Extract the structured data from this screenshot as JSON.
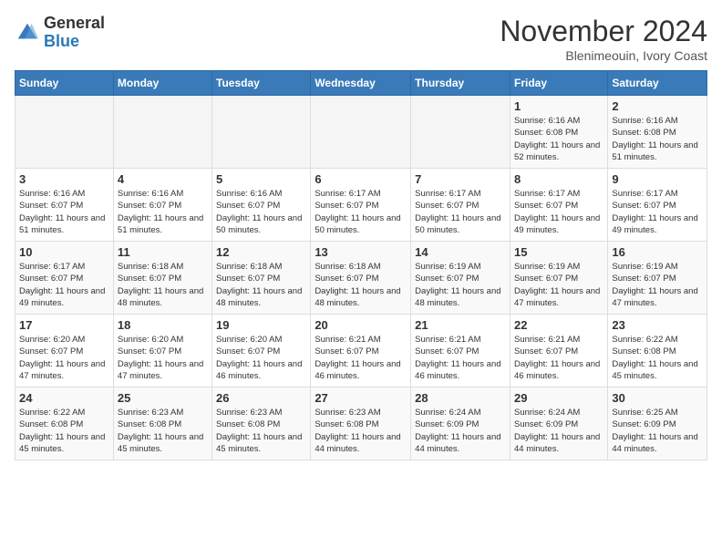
{
  "header": {
    "logo_general": "General",
    "logo_blue": "Blue",
    "title": "November 2024",
    "location": "Blenimeouin, Ivory Coast"
  },
  "days_of_week": [
    "Sunday",
    "Monday",
    "Tuesday",
    "Wednesday",
    "Thursday",
    "Friday",
    "Saturday"
  ],
  "weeks": [
    [
      {
        "day": "",
        "info": ""
      },
      {
        "day": "",
        "info": ""
      },
      {
        "day": "",
        "info": ""
      },
      {
        "day": "",
        "info": ""
      },
      {
        "day": "",
        "info": ""
      },
      {
        "day": "1",
        "info": "Sunrise: 6:16 AM\nSunset: 6:08 PM\nDaylight: 11 hours and 52 minutes."
      },
      {
        "day": "2",
        "info": "Sunrise: 6:16 AM\nSunset: 6:08 PM\nDaylight: 11 hours and 51 minutes."
      }
    ],
    [
      {
        "day": "3",
        "info": "Sunrise: 6:16 AM\nSunset: 6:07 PM\nDaylight: 11 hours and 51 minutes."
      },
      {
        "day": "4",
        "info": "Sunrise: 6:16 AM\nSunset: 6:07 PM\nDaylight: 11 hours and 51 minutes."
      },
      {
        "day": "5",
        "info": "Sunrise: 6:16 AM\nSunset: 6:07 PM\nDaylight: 11 hours and 50 minutes."
      },
      {
        "day": "6",
        "info": "Sunrise: 6:17 AM\nSunset: 6:07 PM\nDaylight: 11 hours and 50 minutes."
      },
      {
        "day": "7",
        "info": "Sunrise: 6:17 AM\nSunset: 6:07 PM\nDaylight: 11 hours and 50 minutes."
      },
      {
        "day": "8",
        "info": "Sunrise: 6:17 AM\nSunset: 6:07 PM\nDaylight: 11 hours and 49 minutes."
      },
      {
        "day": "9",
        "info": "Sunrise: 6:17 AM\nSunset: 6:07 PM\nDaylight: 11 hours and 49 minutes."
      }
    ],
    [
      {
        "day": "10",
        "info": "Sunrise: 6:17 AM\nSunset: 6:07 PM\nDaylight: 11 hours and 49 minutes."
      },
      {
        "day": "11",
        "info": "Sunrise: 6:18 AM\nSunset: 6:07 PM\nDaylight: 11 hours and 48 minutes."
      },
      {
        "day": "12",
        "info": "Sunrise: 6:18 AM\nSunset: 6:07 PM\nDaylight: 11 hours and 48 minutes."
      },
      {
        "day": "13",
        "info": "Sunrise: 6:18 AM\nSunset: 6:07 PM\nDaylight: 11 hours and 48 minutes."
      },
      {
        "day": "14",
        "info": "Sunrise: 6:19 AM\nSunset: 6:07 PM\nDaylight: 11 hours and 48 minutes."
      },
      {
        "day": "15",
        "info": "Sunrise: 6:19 AM\nSunset: 6:07 PM\nDaylight: 11 hours and 47 minutes."
      },
      {
        "day": "16",
        "info": "Sunrise: 6:19 AM\nSunset: 6:07 PM\nDaylight: 11 hours and 47 minutes."
      }
    ],
    [
      {
        "day": "17",
        "info": "Sunrise: 6:20 AM\nSunset: 6:07 PM\nDaylight: 11 hours and 47 minutes."
      },
      {
        "day": "18",
        "info": "Sunrise: 6:20 AM\nSunset: 6:07 PM\nDaylight: 11 hours and 47 minutes."
      },
      {
        "day": "19",
        "info": "Sunrise: 6:20 AM\nSunset: 6:07 PM\nDaylight: 11 hours and 46 minutes."
      },
      {
        "day": "20",
        "info": "Sunrise: 6:21 AM\nSunset: 6:07 PM\nDaylight: 11 hours and 46 minutes."
      },
      {
        "day": "21",
        "info": "Sunrise: 6:21 AM\nSunset: 6:07 PM\nDaylight: 11 hours and 46 minutes."
      },
      {
        "day": "22",
        "info": "Sunrise: 6:21 AM\nSunset: 6:07 PM\nDaylight: 11 hours and 46 minutes."
      },
      {
        "day": "23",
        "info": "Sunrise: 6:22 AM\nSunset: 6:08 PM\nDaylight: 11 hours and 45 minutes."
      }
    ],
    [
      {
        "day": "24",
        "info": "Sunrise: 6:22 AM\nSunset: 6:08 PM\nDaylight: 11 hours and 45 minutes."
      },
      {
        "day": "25",
        "info": "Sunrise: 6:23 AM\nSunset: 6:08 PM\nDaylight: 11 hours and 45 minutes."
      },
      {
        "day": "26",
        "info": "Sunrise: 6:23 AM\nSunset: 6:08 PM\nDaylight: 11 hours and 45 minutes."
      },
      {
        "day": "27",
        "info": "Sunrise: 6:23 AM\nSunset: 6:08 PM\nDaylight: 11 hours and 44 minutes."
      },
      {
        "day": "28",
        "info": "Sunrise: 6:24 AM\nSunset: 6:09 PM\nDaylight: 11 hours and 44 minutes."
      },
      {
        "day": "29",
        "info": "Sunrise: 6:24 AM\nSunset: 6:09 PM\nDaylight: 11 hours and 44 minutes."
      },
      {
        "day": "30",
        "info": "Sunrise: 6:25 AM\nSunset: 6:09 PM\nDaylight: 11 hours and 44 minutes."
      }
    ]
  ]
}
